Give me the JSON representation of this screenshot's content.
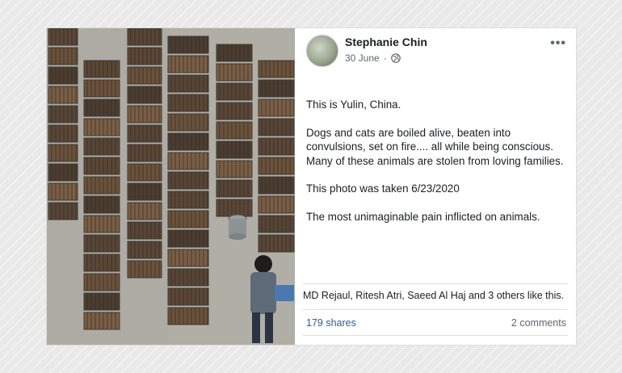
{
  "post": {
    "author": "Stephanie Chin",
    "date": "30 June",
    "privacy_icon": "globe-icon",
    "more_label": "•••",
    "paragraphs": [
      "This is Yulin, China.",
      "Dogs and cats are boiled alive, beaten into convulsions, set on fire.... all while being conscious. Many of these animals are stolen from loving families.",
      "This photo was taken 6/23/2020",
      "The most unimaginable pain inflicted on animals."
    ],
    "likes_text": "MD Rejaul, Ritesh Atri, Saeed Al Haj and 3 others like this.",
    "shares": "179 shares",
    "comments": "2 comments"
  },
  "colors": {
    "link": "#385898",
    "muted": "#606770",
    "text": "#1c1e21"
  }
}
